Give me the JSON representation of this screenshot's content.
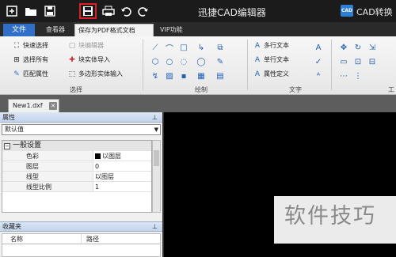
{
  "titlebar": {
    "app_title": "迅捷CAD编辑器",
    "right_logo_text": "CAD",
    "right_text": "CAD转换",
    "quick_access": [
      "new-icon",
      "open-folder-icon",
      "save-icon",
      "save-as-pdf-icon",
      "print-icon",
      "undo-icon",
      "redo-icon"
    ]
  },
  "menu": {
    "file": "文件",
    "tabs": [
      "查看器",
      "保存为PDF格式文档",
      "VIP功能"
    ]
  },
  "ribbon": {
    "group1": {
      "items": [
        "快速选择",
        "选择所有",
        "匹配属性"
      ],
      "items2": [
        "块编辑器",
        "块实体导入",
        "多边形实体输入"
      ],
      "label": "选择"
    },
    "group2": {
      "label": "绘制"
    },
    "group3": {
      "items": [
        "多行文本",
        "单行文本",
        "属性定义"
      ],
      "label": "文字"
    },
    "group4": {
      "label": "工"
    }
  },
  "document": {
    "tab": "New1.dxf"
  },
  "properties": {
    "title": "属性",
    "selector": "默认值",
    "category": "一般设置",
    "rows": [
      {
        "key": "色彩",
        "value": "以图层"
      },
      {
        "key": "图层",
        "value": "0"
      },
      {
        "key": "线型",
        "value": "以图层"
      },
      {
        "key": "线型比例",
        "value": "1"
      }
    ]
  },
  "favorites": {
    "title": "收藏夹",
    "col_name": "名称",
    "col_path": "路径"
  },
  "watermark": "软件技巧",
  "colors": {
    "highlight": "#e02020",
    "file_tab": "#2f6fc8",
    "accent": "#2060b8"
  }
}
